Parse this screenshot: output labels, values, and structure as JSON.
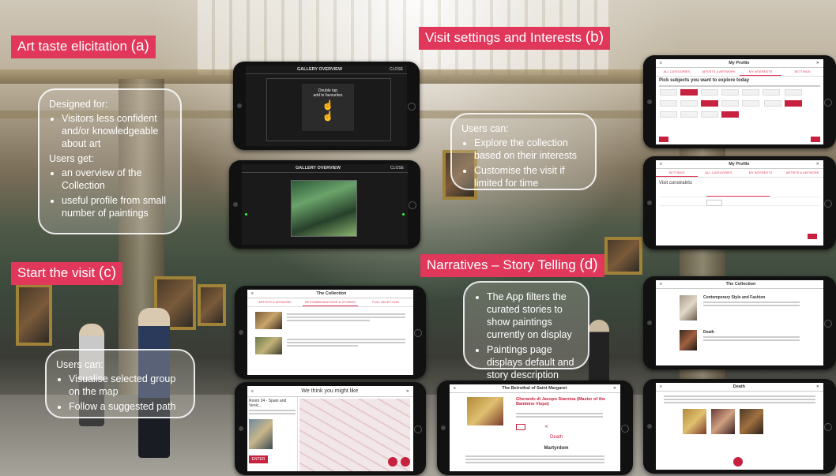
{
  "sections": {
    "a": {
      "title": "Art taste elicitation ",
      "letter": "(a)"
    },
    "b": {
      "title": "Visit settings and Interests ",
      "letter": "(b)"
    },
    "c": {
      "title": "Start the visit ",
      "letter": "(c)"
    },
    "d": {
      "title": "Narratives – Story Telling ",
      "letter": "(d)"
    }
  },
  "notes": {
    "a": {
      "designed_for": "Designed for:",
      "designed_items": [
        "Visitors less confident and/or knowledgeable about art"
      ],
      "users_get": "Users get:",
      "get_items": [
        "an overview of the Collection",
        "useful profile from small number of paintings"
      ]
    },
    "b": {
      "heading": "Users can:",
      "items": [
        "Explore the collection based on their interests",
        "Customise the visit if limited for time"
      ]
    },
    "c": {
      "heading": "Users can:",
      "items": [
        "Visualise selected group on the map",
        "Follow a suggested path"
      ]
    },
    "d": {
      "items": [
        "The App filters the curated stories to show paintings currently on display",
        "Paintings page displays default and story description"
      ]
    }
  },
  "screens": {
    "gallery_overview": "GALLERY OVERVIEW",
    "close": "CLOSE",
    "double_tap": "Double tap",
    "add_favourites": "add to favourites",
    "my_profile": "My Profile",
    "pick_subjects": "Pick subjects you want to explore today",
    "visit_constraints": "Visit constraints",
    "the_collection": "The Collection",
    "we_think": "We think you might like",
    "room": "Room 24 - Spain and Venic...",
    "enter": "ENTER",
    "betrothal": "The Betrothal of Saint Margaret",
    "ghirardi": "Gherardo di Jacopo Starnina (Master of the Bambino Vispo)",
    "death": "Death",
    "martyrdom": "Martyrdom",
    "contemporary": "Contemporary Style and Fashion",
    "death2": "Death",
    "tab_all": "ALL CATEGORIES",
    "tab_interests": "MY INTERESTS",
    "tab_settings": "SETTINGS",
    "tab_recommendations": "RECOMMENDATIONS & STORIES",
    "tab_full": "FULL SELECTION",
    "tab_artists": "ARTISTS & ARTWORK"
  },
  "colors": {
    "accent": "#e0375a"
  }
}
